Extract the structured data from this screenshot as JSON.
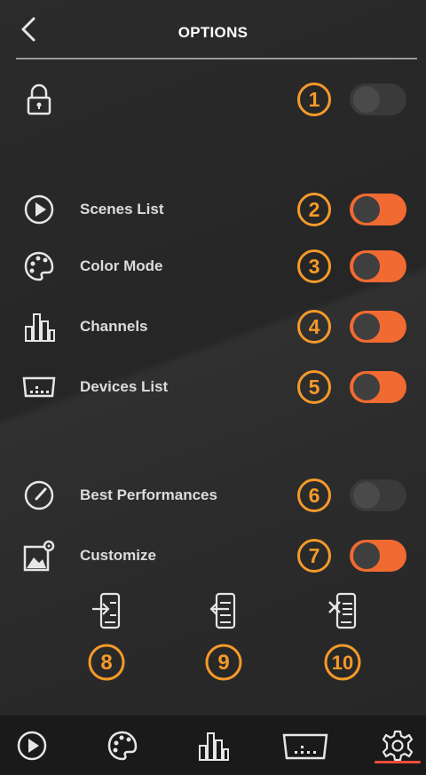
{
  "header": {
    "title": "OPTIONS"
  },
  "rows": [
    {
      "id": "lock",
      "label": "",
      "badge": "1",
      "on": false
    },
    {
      "id": "scenes",
      "label": "Scenes List",
      "badge": "2",
      "on": true
    },
    {
      "id": "color",
      "label": "Color Mode",
      "badge": "3",
      "on": true
    },
    {
      "id": "channels",
      "label": "Channels",
      "badge": "4",
      "on": true
    },
    {
      "id": "devices",
      "label": "Devices List",
      "badge": "5",
      "on": true
    },
    {
      "id": "performance",
      "label": "Best Performances",
      "badge": "6",
      "on": false
    },
    {
      "id": "customize",
      "label": "Customize",
      "badge": "7",
      "on": true
    }
  ],
  "actions": [
    {
      "id": "import",
      "badge": "8"
    },
    {
      "id": "export",
      "badge": "9"
    },
    {
      "id": "delete",
      "badge": "10"
    }
  ],
  "tabbar": {
    "active": "settings"
  },
  "colors": {
    "accent": "#f06a31",
    "badge": "#f59a2a",
    "indicator": "#f04c3a"
  }
}
